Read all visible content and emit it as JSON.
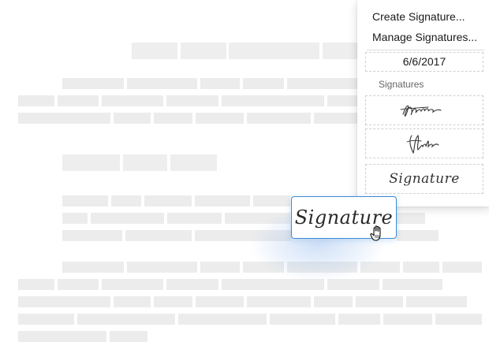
{
  "menu": {
    "create_label": "Create Signature...",
    "manage_label": "Manage Signatures...",
    "date_value": "6/6/2017",
    "section_label": "Signatures",
    "signatures": [
      {
        "type": "handwritten",
        "icon": "signature-scribble-1"
      },
      {
        "type": "handwritten",
        "icon": "signature-scribble-2"
      },
      {
        "type": "typed",
        "text": "Signature"
      }
    ]
  },
  "dragged_signature": {
    "text": "Signature",
    "accent": "#3d8bd4"
  },
  "cursor": {
    "icon": "grab-hand-cursor-icon"
  }
}
